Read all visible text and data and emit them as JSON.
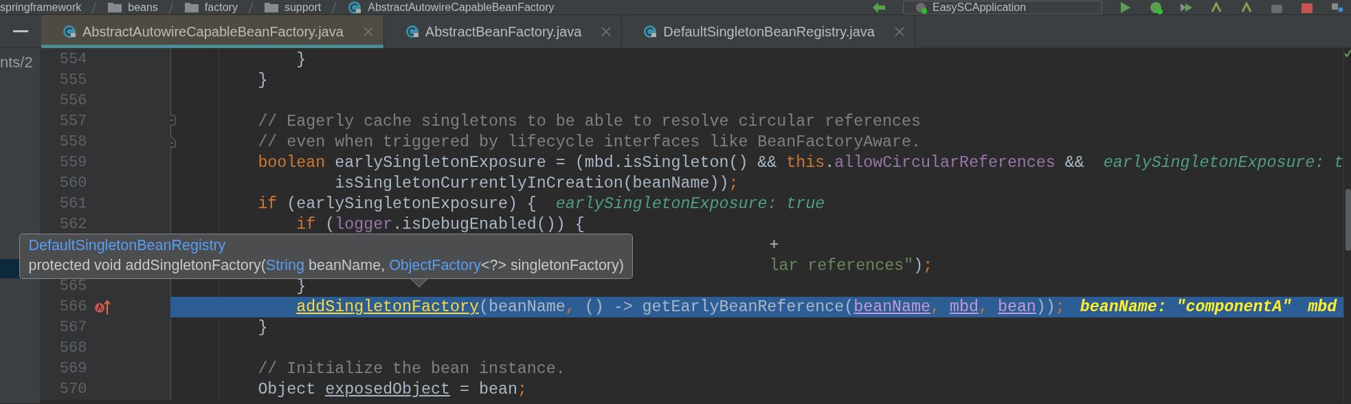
{
  "breadcrumb": {
    "items": [
      {
        "text": "springframework",
        "kind": "root"
      },
      {
        "text": "beans",
        "kind": "folder"
      },
      {
        "text": "factory",
        "kind": "folder"
      },
      {
        "text": "support",
        "kind": "folder"
      },
      {
        "text": "AbstractAutowireCapableBeanFactory",
        "kind": "class"
      }
    ],
    "run_config": "EasySCApplication"
  },
  "tabs": [
    {
      "label": "AbstractAutowireCapableBeanFactory.java",
      "selected": true
    },
    {
      "label": "AbstractBeanFactory.java",
      "selected": false
    },
    {
      "label": "DefaultSingletonBeanRegistry.java",
      "selected": false
    }
  ],
  "project_tree": {
    "text": "nts/2"
  },
  "lines": [
    {
      "number": "554",
      "tokens": [
        {
          "kind": "plain",
          "text": "        }"
        }
      ]
    },
    {
      "number": "555",
      "tokens": [
        {
          "kind": "plain",
          "text": "    }"
        }
      ]
    },
    {
      "number": "556"
    },
    {
      "number": "557",
      "fold_start": true,
      "tokens": [
        {
          "kind": "comment",
          "text": "    // Eagerly cache singletons to be able to resolve circular references"
        }
      ]
    },
    {
      "number": "558",
      "fold_end": true,
      "tokens": [
        {
          "kind": "comment",
          "text": "    // even when triggered by lifecycle interfaces like BeanFactoryAware."
        }
      ]
    },
    {
      "number": "559",
      "tokens": [
        {
          "kind": "keyword",
          "text": "    boolean"
        },
        {
          "kind": "plain",
          "text": " earlySingletonExposure = (mbd.isSingleton() && "
        },
        {
          "kind": "keyword",
          "text": "this"
        },
        {
          "kind": "plain",
          "text": "."
        },
        {
          "kind": "field",
          "text": "allowCircularReferences"
        },
        {
          "kind": "plain",
          "text": " &&"
        }
      ],
      "hints": [
        "earlySingletonExposure: t"
      ]
    },
    {
      "number": "560",
      "tokens": [
        {
          "kind": "plain",
          "text": "            isSingletonCurrentlyInCreation(beanName))"
        },
        {
          "kind": "keyword",
          "text": ";"
        }
      ]
    },
    {
      "number": "561",
      "tokens": [
        {
          "kind": "keyword",
          "text": "    if"
        },
        {
          "kind": "plain",
          "text": " (earlySingletonExposure) {"
        }
      ],
      "hints": [
        "earlySingletonExposure: true"
      ]
    },
    {
      "number": "562",
      "tokens": [
        {
          "kind": "keyword",
          "text": "        if"
        },
        {
          "kind": "plain",
          "text": " ("
        },
        {
          "kind": "field",
          "text": "logger"
        },
        {
          "kind": "plain",
          "text": ".isDebugEnabled()) {"
        }
      ]
    },
    {
      "covered": true,
      "tokens": [
        {
          "kind": "plain",
          "text": "+"
        }
      ]
    },
    {
      "covered": true,
      "tokens": [
        {
          "kind": "string",
          "text": "lar references\""
        },
        {
          "kind": "plain",
          "text": ")"
        },
        {
          "kind": "keyword",
          "text": ";"
        }
      ]
    },
    {
      "number": "565",
      "tokens": [
        {
          "kind": "plain",
          "text": "        }"
        }
      ]
    },
    {
      "number": "566",
      "current": true,
      "lambda_marker": true,
      "tokens": [
        {
          "kind": "call",
          "text": "        addSingletonFactory"
        },
        {
          "kind": "plain",
          "text": "(beanName"
        },
        {
          "kind": "keyword",
          "text": ", "
        },
        {
          "kind": "plain",
          "text": "() -> getEarlyBeanReference("
        },
        {
          "kind": "captured",
          "text": "beanName"
        },
        {
          "kind": "keyword",
          "text": ", "
        },
        {
          "kind": "captured",
          "text": "mbd"
        },
        {
          "kind": "keyword",
          "text": ", "
        },
        {
          "kind": "captured",
          "text": "bean"
        },
        {
          "kind": "plain",
          "text": "))"
        },
        {
          "kind": "keyword",
          "text": ";"
        }
      ],
      "hints": [
        "beanName: \"componentA\"",
        "mbd"
      ]
    },
    {
      "number": "567",
      "tokens": [
        {
          "kind": "plain",
          "text": "    }"
        }
      ]
    },
    {
      "number": "568"
    },
    {
      "number": "569",
      "tokens": [
        {
          "kind": "comment",
          "text": "    // Initialize the bean instance."
        }
      ]
    },
    {
      "number": "570",
      "tokens": [
        {
          "kind": "plain",
          "text": "    Object "
        },
        {
          "kind": "underlined",
          "text": "exposedObject"
        },
        {
          "kind": "plain",
          "text": " = bean"
        },
        {
          "kind": "keyword",
          "text": ";"
        }
      ]
    }
  ],
  "tooltip": {
    "title": "DefaultSingletonBeanRegistry",
    "signature": [
      {
        "kind": "plain",
        "text": "protected void addSingletonFactory("
      },
      {
        "kind": "type",
        "text": "String"
      },
      {
        "kind": "plain",
        "text": " beanName, "
      },
      {
        "kind": "type",
        "text": "ObjectFactory"
      },
      {
        "kind": "plain",
        "text": "<?> singletonFactory)"
      }
    ]
  }
}
